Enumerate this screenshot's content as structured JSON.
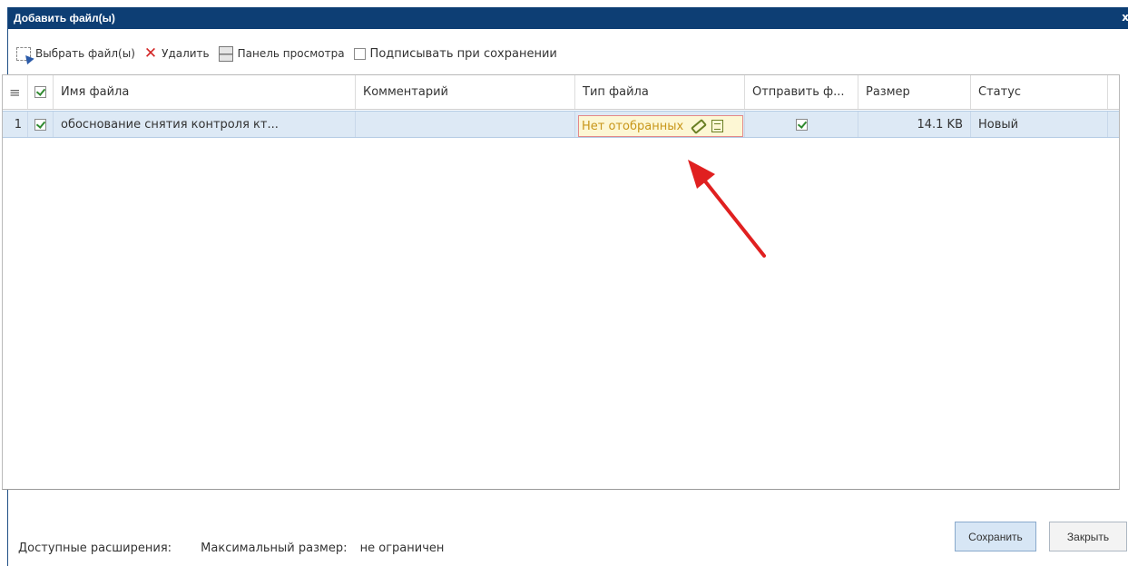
{
  "window": {
    "title": "Добавить файл(ы)",
    "close_glyph": "x"
  },
  "toolbar": {
    "select_files": "Выбрать файл(ы)",
    "delete": "Удалить",
    "preview_panel": "Панель просмотра",
    "sign_on_save": "Подписывать при сохранении",
    "sign_on_save_checked": false
  },
  "grid": {
    "columns": [
      "≡",
      "",
      "Имя файла",
      "Комментарий",
      "Тип файла",
      "Отправить ф...",
      "Размер",
      "Статус"
    ],
    "rows": [
      {
        "num": "1",
        "checked": true,
        "file_name": "обоснование снятия контроля кт...",
        "comment": "",
        "file_type": "Нет отобранных",
        "send": true,
        "size": "14.1 KB",
        "status": "Новый"
      }
    ]
  },
  "footer": {
    "extensions_label": "Доступные расширения:",
    "max_size_label": "Максимальный размер:",
    "max_size_value": "не ограничен"
  },
  "buttons": {
    "save": "Сохранить",
    "close": "Закрыть"
  },
  "colors": {
    "titlebar": "#0d3e74",
    "row_selected": "#dde9f5",
    "arrow": "#e02020",
    "file_type_text": "#c8961a"
  },
  "icons": [
    "select-files-icon",
    "delete-x-icon",
    "preview-panel-icon",
    "eraser-icon",
    "lookup-icon",
    "menu-icon"
  ]
}
